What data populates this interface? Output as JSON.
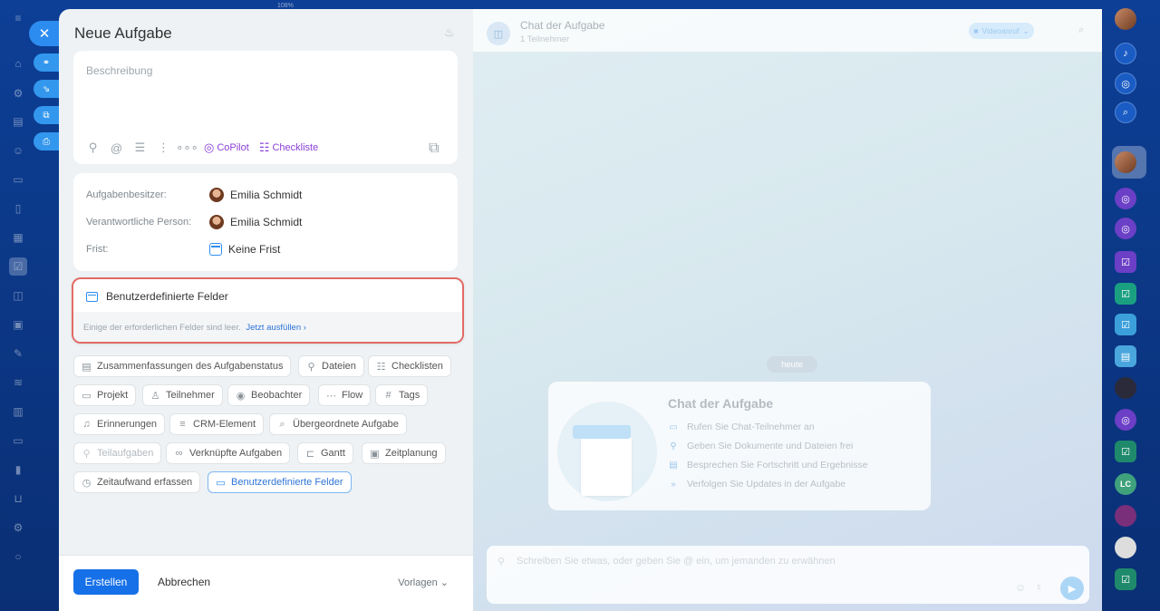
{
  "window": {
    "zoom_label": "108%"
  },
  "form": {
    "title": "Neue Aufgabe",
    "description_placeholder": "Beschreibung",
    "toolbar": {
      "copilot_label": "CoPilot",
      "checklist_label": "Checkliste"
    },
    "people": {
      "owner_label": "Aufgabenbesitzer:",
      "owner_value": "Emilia Schmidt",
      "responsible_label": "Verantwortliche Person:",
      "responsible_value": "Emilia Schmidt",
      "deadline_label": "Frist:",
      "deadline_value": "Keine Frist"
    },
    "custom_fields": {
      "title": "Benutzerdefinierte Felder",
      "notice": "Einige der erforderlichen Felder sind leer.",
      "fill_link": "Jetzt ausfüllen"
    },
    "chips": [
      {
        "label": "Zusammenfassungen des Aufgabenstatus",
        "icon": "summary-icon"
      },
      {
        "label": "Dateien",
        "icon": "paperclip-icon"
      },
      {
        "label": "Checklisten",
        "icon": "checklist-icon"
      },
      {
        "label": "Projekt",
        "icon": "folder-icon"
      },
      {
        "label": "Teilnehmer",
        "icon": "person-icon"
      },
      {
        "label": "Beobachter",
        "icon": "eye-icon"
      },
      {
        "label": "Flow",
        "icon": "flow-icon"
      },
      {
        "label": "Tags",
        "icon": "hash-icon"
      },
      {
        "label": "Erinnerungen",
        "icon": "bell-icon"
      },
      {
        "label": "CRM-Element",
        "icon": "crm-icon"
      },
      {
        "label": "Übergeordnete Aufgabe",
        "icon": "parent-task-icon"
      },
      {
        "label": "Teilaufgaben",
        "icon": "subtask-icon"
      },
      {
        "label": "Verknüpfte Aufgaben",
        "icon": "link-icon"
      },
      {
        "label": "Gantt",
        "icon": "gantt-icon"
      },
      {
        "label": "Zeitplanung",
        "icon": "schedule-icon"
      },
      {
        "label": "Zeitaufwand erfassen",
        "icon": "stopwatch-icon"
      },
      {
        "label": "Benutzerdefinierte Felder",
        "icon": "custom-fields-icon"
      }
    ],
    "footer": {
      "create_label": "Erstellen",
      "cancel_label": "Abbrechen",
      "templates_label": "Vorlagen"
    }
  },
  "chat": {
    "title": "Chat der Aufgabe",
    "subtitle": "1 Teilnehmer",
    "video_label": "Videoanruf",
    "date_label": "heute",
    "welcome": {
      "title": "Chat der Aufgabe",
      "lines": [
        "Rufen Sie Chat-Teilnehmer an",
        "Geben Sie Dokumente und Dateien frei",
        "Besprechen Sie Fortschritt und Ergebnisse",
        "Verfolgen Sie Updates in der Aufgabe"
      ]
    },
    "composer_placeholder": "Schreiben Sie etwas, oder geben Sie @ ein, um jemanden zu erwähnen"
  },
  "right_sidebar": {
    "lc_badge": "LC"
  },
  "colors": {
    "accent": "#1670e8",
    "highlight": "#e26b66",
    "copilot": "#8c40d8"
  }
}
